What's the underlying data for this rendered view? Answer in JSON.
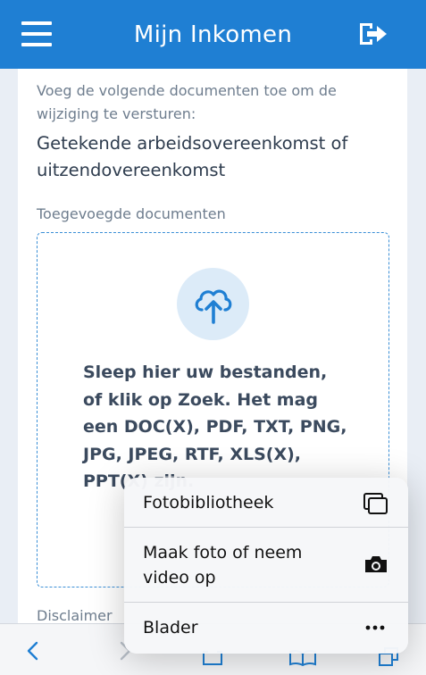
{
  "header": {
    "title": "Mijn Inkomen",
    "menu_icon": "hamburger-menu-icon",
    "logout_icon": "logout-icon"
  },
  "content": {
    "intro": "Voeg de volgende documenten toe om de wijziging te versturen:",
    "required_document": "Getekende arbeidsovereenkomst of uitzendovereenkomst",
    "added_documents_label": "Toegevoegde documenten",
    "upload_icon": "cloud-upload-icon",
    "dropzone_text": "Sleep hier uw bestanden, of klik op Zoek. Het mag een DOC(X), PDF, TXT, PNG, JPG, JPEG, RTF, XLS(X), PPT(X) zijn.",
    "disclaimer": "Disclaimer"
  },
  "popup_menu": {
    "items": [
      {
        "label": "Fotobibliotheek",
        "icon": "photo-library-icon"
      },
      {
        "label": "Maak foto of neem video op",
        "icon": "camera-icon"
      },
      {
        "label": "Blader",
        "icon": "more-dots-icon"
      }
    ]
  },
  "browser_toolbar": {
    "icons": [
      "back-icon",
      "forward-icon",
      "share-icon",
      "bookmarks-icon",
      "tabs-icon"
    ]
  },
  "colors": {
    "header_bg": "#1f7fd3",
    "dropzone_border": "#3b8fd6",
    "upload_icon_bg": "#dcebf8",
    "page_bg": "#e9eef5"
  }
}
